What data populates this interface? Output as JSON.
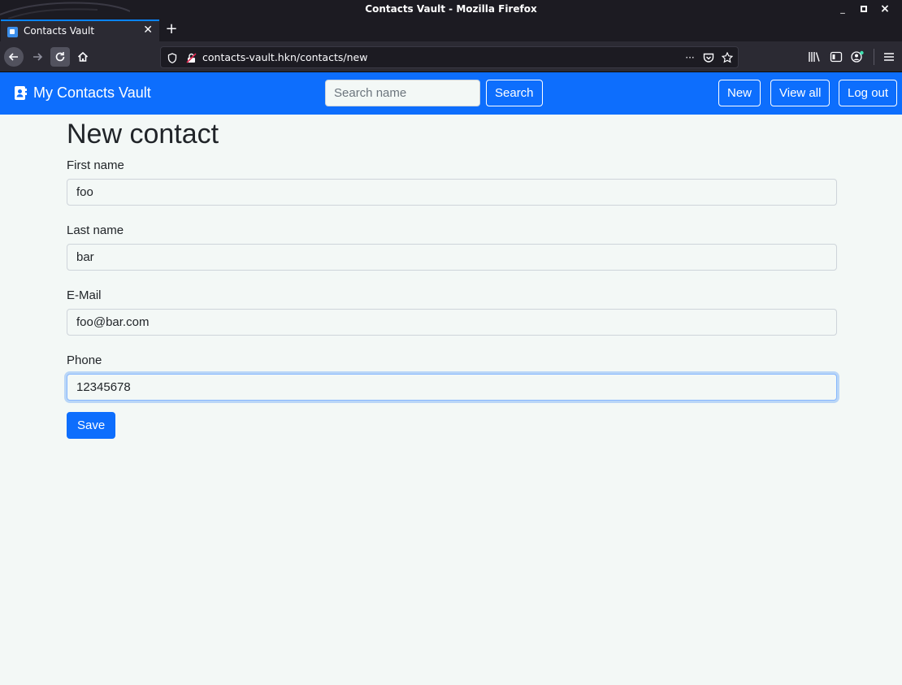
{
  "window": {
    "title": "Contacts Vault - Mozilla Firefox",
    "controls": {
      "minimize": "_",
      "maximize": "▫",
      "close": "×"
    }
  },
  "browser": {
    "tab": {
      "label": "Contacts Vault",
      "icon": "contact-card-icon"
    },
    "new_tab_symbol": "+",
    "url": "contacts-vault.hkn/contacts/new",
    "page_actions_symbol": "···",
    "accent_color": "#0a84ff"
  },
  "site": {
    "brand": "My Contacts Vault",
    "brand_icon": "address-book-icon",
    "search": {
      "placeholder": "Search name",
      "value": ""
    },
    "search_button": "Search",
    "nav_buttons": {
      "new": "New",
      "view_all": "View all",
      "logout": "Log out"
    },
    "primary_color": "#0d6efd"
  },
  "form": {
    "title": "New contact",
    "fields": [
      {
        "label": "First name",
        "value": "foo"
      },
      {
        "label": "Last name",
        "value": "bar"
      },
      {
        "label": "E-Mail",
        "value": "foo@bar.com"
      },
      {
        "label": "Phone",
        "value": "12345678",
        "focused": true
      }
    ],
    "submit_label": "Save"
  }
}
